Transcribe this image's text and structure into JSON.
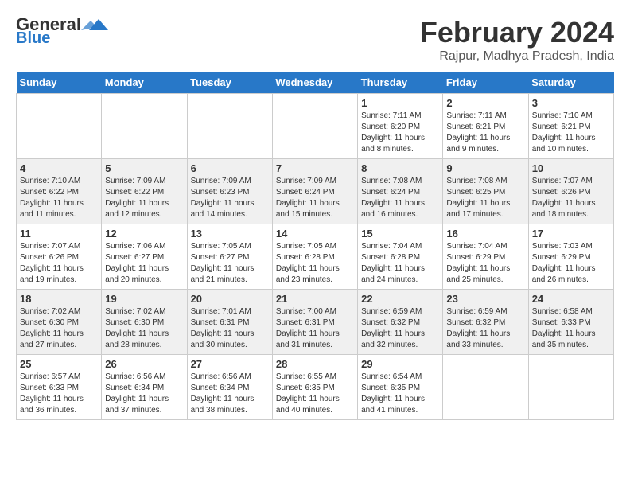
{
  "logo": {
    "general": "General",
    "blue": "Blue"
  },
  "header": {
    "month_year": "February 2024",
    "location": "Rajpur, Madhya Pradesh, India"
  },
  "weekdays": [
    "Sunday",
    "Monday",
    "Tuesday",
    "Wednesday",
    "Thursday",
    "Friday",
    "Saturday"
  ],
  "weeks": [
    [
      {
        "day": "",
        "sunrise": "",
        "sunset": "",
        "daylight": ""
      },
      {
        "day": "",
        "sunrise": "",
        "sunset": "",
        "daylight": ""
      },
      {
        "day": "",
        "sunrise": "",
        "sunset": "",
        "daylight": ""
      },
      {
        "day": "",
        "sunrise": "",
        "sunset": "",
        "daylight": ""
      },
      {
        "day": "1",
        "sunrise": "Sunrise: 7:11 AM",
        "sunset": "Sunset: 6:20 PM",
        "daylight": "Daylight: 11 hours and 8 minutes."
      },
      {
        "day": "2",
        "sunrise": "Sunrise: 7:11 AM",
        "sunset": "Sunset: 6:21 PM",
        "daylight": "Daylight: 11 hours and 9 minutes."
      },
      {
        "day": "3",
        "sunrise": "Sunrise: 7:10 AM",
        "sunset": "Sunset: 6:21 PM",
        "daylight": "Daylight: 11 hours and 10 minutes."
      }
    ],
    [
      {
        "day": "4",
        "sunrise": "Sunrise: 7:10 AM",
        "sunset": "Sunset: 6:22 PM",
        "daylight": "Daylight: 11 hours and 11 minutes."
      },
      {
        "day": "5",
        "sunrise": "Sunrise: 7:09 AM",
        "sunset": "Sunset: 6:22 PM",
        "daylight": "Daylight: 11 hours and 12 minutes."
      },
      {
        "day": "6",
        "sunrise": "Sunrise: 7:09 AM",
        "sunset": "Sunset: 6:23 PM",
        "daylight": "Daylight: 11 hours and 14 minutes."
      },
      {
        "day": "7",
        "sunrise": "Sunrise: 7:09 AM",
        "sunset": "Sunset: 6:24 PM",
        "daylight": "Daylight: 11 hours and 15 minutes."
      },
      {
        "day": "8",
        "sunrise": "Sunrise: 7:08 AM",
        "sunset": "Sunset: 6:24 PM",
        "daylight": "Daylight: 11 hours and 16 minutes."
      },
      {
        "day": "9",
        "sunrise": "Sunrise: 7:08 AM",
        "sunset": "Sunset: 6:25 PM",
        "daylight": "Daylight: 11 hours and 17 minutes."
      },
      {
        "day": "10",
        "sunrise": "Sunrise: 7:07 AM",
        "sunset": "Sunset: 6:26 PM",
        "daylight": "Daylight: 11 hours and 18 minutes."
      }
    ],
    [
      {
        "day": "11",
        "sunrise": "Sunrise: 7:07 AM",
        "sunset": "Sunset: 6:26 PM",
        "daylight": "Daylight: 11 hours and 19 minutes."
      },
      {
        "day": "12",
        "sunrise": "Sunrise: 7:06 AM",
        "sunset": "Sunset: 6:27 PM",
        "daylight": "Daylight: 11 hours and 20 minutes."
      },
      {
        "day": "13",
        "sunrise": "Sunrise: 7:05 AM",
        "sunset": "Sunset: 6:27 PM",
        "daylight": "Daylight: 11 hours and 21 minutes."
      },
      {
        "day": "14",
        "sunrise": "Sunrise: 7:05 AM",
        "sunset": "Sunset: 6:28 PM",
        "daylight": "Daylight: 11 hours and 23 minutes."
      },
      {
        "day": "15",
        "sunrise": "Sunrise: 7:04 AM",
        "sunset": "Sunset: 6:28 PM",
        "daylight": "Daylight: 11 hours and 24 minutes."
      },
      {
        "day": "16",
        "sunrise": "Sunrise: 7:04 AM",
        "sunset": "Sunset: 6:29 PM",
        "daylight": "Daylight: 11 hours and 25 minutes."
      },
      {
        "day": "17",
        "sunrise": "Sunrise: 7:03 AM",
        "sunset": "Sunset: 6:29 PM",
        "daylight": "Daylight: 11 hours and 26 minutes."
      }
    ],
    [
      {
        "day": "18",
        "sunrise": "Sunrise: 7:02 AM",
        "sunset": "Sunset: 6:30 PM",
        "daylight": "Daylight: 11 hours and 27 minutes."
      },
      {
        "day": "19",
        "sunrise": "Sunrise: 7:02 AM",
        "sunset": "Sunset: 6:30 PM",
        "daylight": "Daylight: 11 hours and 28 minutes."
      },
      {
        "day": "20",
        "sunrise": "Sunrise: 7:01 AM",
        "sunset": "Sunset: 6:31 PM",
        "daylight": "Daylight: 11 hours and 30 minutes."
      },
      {
        "day": "21",
        "sunrise": "Sunrise: 7:00 AM",
        "sunset": "Sunset: 6:31 PM",
        "daylight": "Daylight: 11 hours and 31 minutes."
      },
      {
        "day": "22",
        "sunrise": "Sunrise: 6:59 AM",
        "sunset": "Sunset: 6:32 PM",
        "daylight": "Daylight: 11 hours and 32 minutes."
      },
      {
        "day": "23",
        "sunrise": "Sunrise: 6:59 AM",
        "sunset": "Sunset: 6:32 PM",
        "daylight": "Daylight: 11 hours and 33 minutes."
      },
      {
        "day": "24",
        "sunrise": "Sunrise: 6:58 AM",
        "sunset": "Sunset: 6:33 PM",
        "daylight": "Daylight: 11 hours and 35 minutes."
      }
    ],
    [
      {
        "day": "25",
        "sunrise": "Sunrise: 6:57 AM",
        "sunset": "Sunset: 6:33 PM",
        "daylight": "Daylight: 11 hours and 36 minutes."
      },
      {
        "day": "26",
        "sunrise": "Sunrise: 6:56 AM",
        "sunset": "Sunset: 6:34 PM",
        "daylight": "Daylight: 11 hours and 37 minutes."
      },
      {
        "day": "27",
        "sunrise": "Sunrise: 6:56 AM",
        "sunset": "Sunset: 6:34 PM",
        "daylight": "Daylight: 11 hours and 38 minutes."
      },
      {
        "day": "28",
        "sunrise": "Sunrise: 6:55 AM",
        "sunset": "Sunset: 6:35 PM",
        "daylight": "Daylight: 11 hours and 40 minutes."
      },
      {
        "day": "29",
        "sunrise": "Sunrise: 6:54 AM",
        "sunset": "Sunset: 6:35 PM",
        "daylight": "Daylight: 11 hours and 41 minutes."
      },
      {
        "day": "",
        "sunrise": "",
        "sunset": "",
        "daylight": ""
      },
      {
        "day": "",
        "sunrise": "",
        "sunset": "",
        "daylight": ""
      }
    ]
  ]
}
